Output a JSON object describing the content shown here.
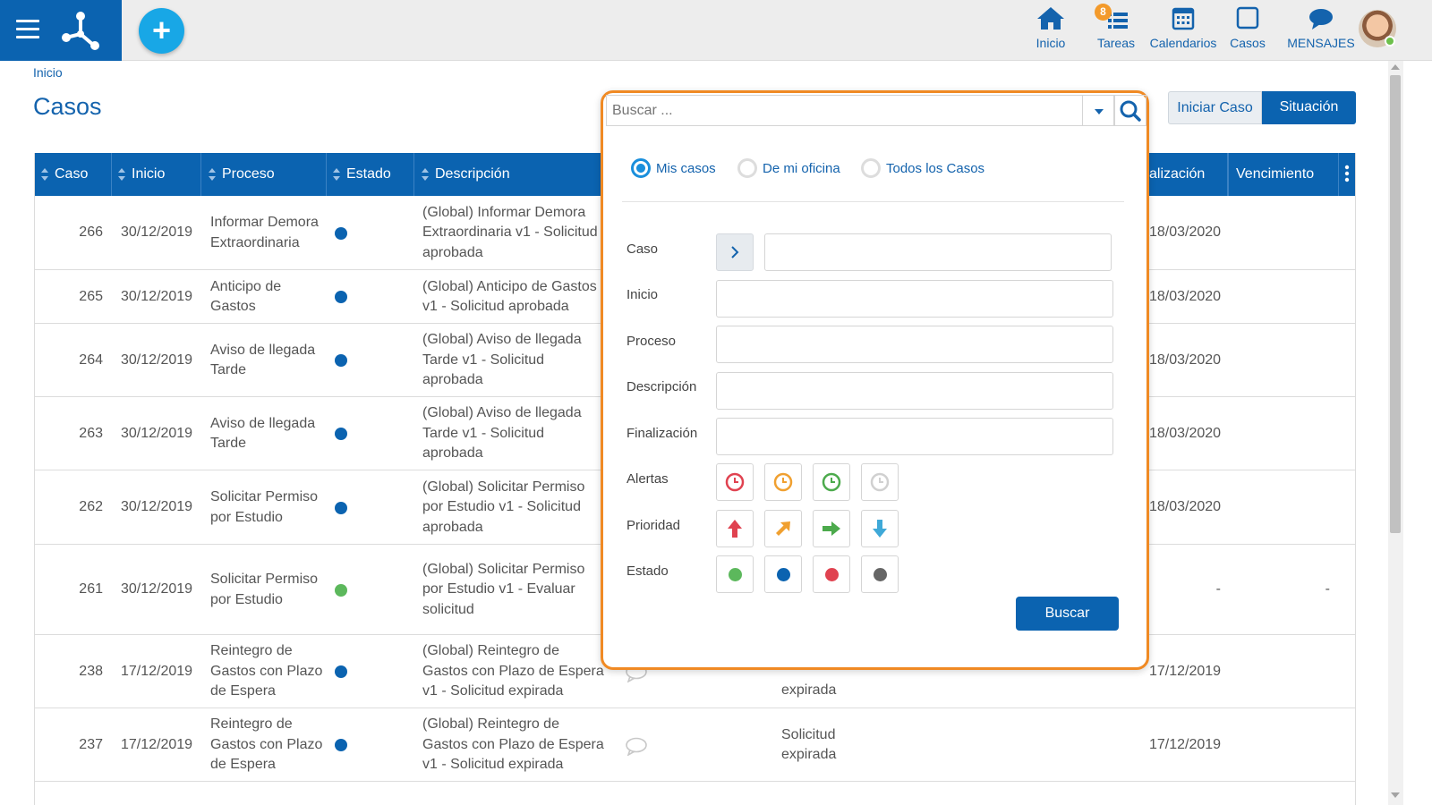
{
  "nav": {
    "inicio": "Inicio",
    "tareas": "Tareas",
    "tareas_badge": "8",
    "calendarios": "Calendarios",
    "casos": "Casos",
    "mensajes": "MENSAJES"
  },
  "breadcrumb": "Inicio",
  "page_title": "Casos",
  "actions": {
    "iniciar": "Iniciar Caso",
    "situacion": "Situación"
  },
  "columns": {
    "caso": "Caso",
    "inicio": "Inicio",
    "proceso": "Proceso",
    "estado": "Estado",
    "descripcion": "Descripción",
    "finalizacion": "alización",
    "vencimiento": "Vencimiento"
  },
  "colors": {
    "blue": "#0b63b0",
    "status_blue": "#0b63b0",
    "status_green": "#5cb85c",
    "status_red": "#e04250",
    "status_gray": "#666666",
    "accent_orange": "#f08a24"
  },
  "rows": [
    {
      "id": "266",
      "start": "30/12/2019",
      "process": "Informar Demora Extraordinaria",
      "status": "blue",
      "desc": "(Global) Informar Demora Extraordinaria v1 - Solicitud aprobada",
      "state": "",
      "end": "18/03/2020",
      "due": ""
    },
    {
      "id": "265",
      "start": "30/12/2019",
      "process": "Anticipo de Gastos",
      "status": "blue",
      "desc": "(Global) Anticipo de Gastos v1 - Solicitud aprobada",
      "state": "",
      "end": "18/03/2020",
      "due": ""
    },
    {
      "id": "264",
      "start": "30/12/2019",
      "process": "Aviso de llegada Tarde",
      "status": "blue",
      "desc": "(Global) Aviso de llegada Tarde v1 - Solicitud aprobada",
      "state": "",
      "end": "18/03/2020",
      "due": ""
    },
    {
      "id": "263",
      "start": "30/12/2019",
      "process": "Aviso de llegada Tarde",
      "status": "blue",
      "desc": "(Global) Aviso de llegada Tarde v1 - Solicitud aprobada",
      "state": "",
      "end": "18/03/2020",
      "due": ""
    },
    {
      "id": "262",
      "start": "30/12/2019",
      "process": "Solicitar Permiso por Estudio",
      "status": "blue",
      "desc": "(Global) Solicitar Permiso por Estudio v1 - Solicitud aprobada",
      "state": "",
      "end": "18/03/2020",
      "due": ""
    },
    {
      "id": "261",
      "start": "30/12/2019",
      "process": "Solicitar Permiso por Estudio",
      "status": "green",
      "desc": "(Global) Solicitar Permiso por Estudio v1 - Evaluar solicitud",
      "state": "",
      "end": "-",
      "due": "-"
    },
    {
      "id": "238",
      "start": "17/12/2019",
      "process": "Reintegro de Gastos con Plazo de Espera",
      "status": "blue",
      "desc": "(Global) Reintegro de Gastos con Plazo de Espera v1 - Solicitud expirada",
      "state": "expirada",
      "end": "17/12/2019",
      "due": ""
    },
    {
      "id": "237",
      "start": "17/12/2019",
      "process": "Reintegro de Gastos con Plazo de Espera",
      "status": "blue",
      "desc": "(Global) Reintegro de Gastos con Plazo de Espera v1 - Solicitud expirada",
      "state": "Solicitud expirada",
      "end": "17/12/2019",
      "due": ""
    }
  ],
  "search": {
    "placeholder": "Buscar ...",
    "scope": [
      "Mis casos",
      "De mi oficina",
      "Todos los Casos"
    ],
    "labels": {
      "caso": "Caso",
      "inicio": "Inicio",
      "proceso": "Proceso",
      "descripcion": "Descripción",
      "finalizacion": "Finalización",
      "alertas": "Alertas",
      "prioridad": "Prioridad",
      "estado": "Estado"
    },
    "button": "Buscar"
  }
}
